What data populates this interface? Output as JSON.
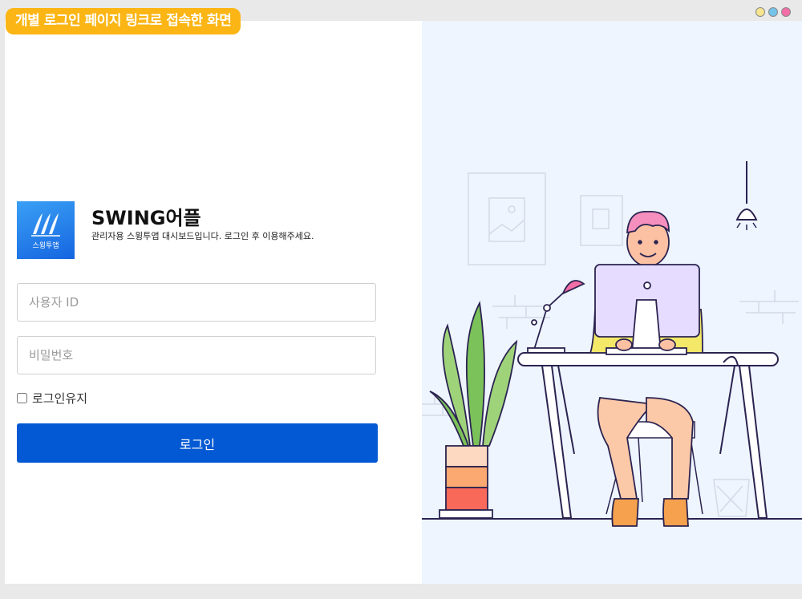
{
  "caption": "개별 로그인 페이지 링크로 접속한 화면",
  "window_dots": [
    {
      "name": "yellow",
      "color": "#f6e58d"
    },
    {
      "name": "blue",
      "color": "#74c3e8"
    },
    {
      "name": "pink",
      "color": "#f26ea6"
    }
  ],
  "brand": {
    "logo_text": "스윙투앱",
    "title": "SWING어플",
    "subtitle": "관리자용 스윙투앱 대시보드입니다. 로그인 후 이용해주세요."
  },
  "form": {
    "user_placeholder": "사용자 ID",
    "password_placeholder": "비밀번호",
    "remember_label": "로그인유지",
    "submit_label": "로그인"
  },
  "colors": {
    "accent": "#0359d3",
    "badge": "#fbb514",
    "illustration_bg": "#eef5ff"
  }
}
